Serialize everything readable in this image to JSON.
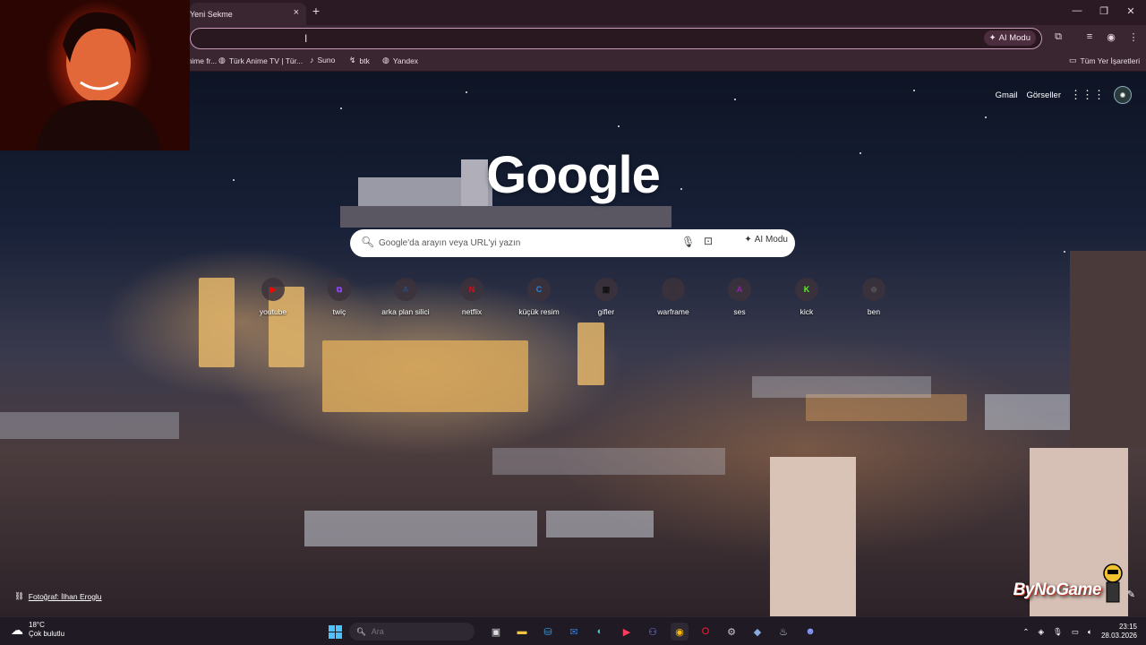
{
  "browser": {
    "tab_title": "Yeni Sekme",
    "tab_close": "×",
    "new_tab": "+",
    "address_value": "",
    "ai_mode_label": "AI Modu",
    "bookmarks": [
      {
        "label": "Anime fr...",
        "icon": "globe-icon"
      },
      {
        "label": "Türk Anime TV | Tür...",
        "icon": "globe-icon"
      },
      {
        "label": "Suno",
        "icon": "suno-icon"
      },
      {
        "label": "btk",
        "icon": "btk-icon"
      },
      {
        "label": "Yandex",
        "icon": "globe-icon"
      }
    ],
    "all_bookmarks_label": "Tüm Yer İşaretleri"
  },
  "ntp": {
    "gmail_label": "Gmail",
    "images_label": "Görseller",
    "logo": "Google",
    "search_placeholder": "Google'da arayın veya URL'yi yazın",
    "ai_mode_label": "AI Modu",
    "shortcuts": [
      {
        "label": "youtube",
        "glyph": "▶",
        "color": "#ff0000"
      },
      {
        "label": "twiç",
        "glyph": "⧉",
        "color": "#9146ff"
      },
      {
        "label": "arka plan silici",
        "glyph": "A",
        "color": "#2b4c7e"
      },
      {
        "label": "netflix",
        "glyph": "N",
        "color": "#e50914"
      },
      {
        "label": "küçük resim",
        "glyph": "C",
        "color": "#1e88e5"
      },
      {
        "label": "gifler",
        "glyph": "▦",
        "color": "#111111"
      },
      {
        "label": "warframe",
        "glyph": "O",
        "color": "#333333"
      },
      {
        "label": "ses",
        "glyph": "A",
        "color": "#8e24aa"
      },
      {
        "label": "kick",
        "glyph": "K",
        "color": "#53fc18"
      },
      {
        "label": "ben",
        "glyph": "⊛",
        "color": "#555555"
      }
    ],
    "photo_credit": "Fotoğraf: İlhan Eroglu",
    "watermark": "ByNoGame"
  },
  "taskbar": {
    "temperature": "18°C",
    "weather_desc": "Çok bulutlu",
    "search_placeholder": "Ara",
    "time": "23:15",
    "date": "28.03.2026"
  },
  "colors": {
    "accent": "#c89ab5",
    "chrome_bg": "#3a2631",
    "taskbar_bg": "#1f1a24"
  }
}
